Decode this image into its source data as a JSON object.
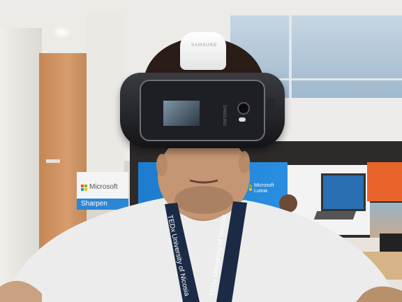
{
  "scene": {
    "kind": "photo",
    "description_colors": {
      "wall": "#e8e6e2",
      "wood_door": "#c98f60",
      "glass_panel": "#a9c2d6",
      "tshirt": "#ebebeb",
      "headset": "#1c1c20",
      "lanyard": "#1b2b45",
      "brand_blue": "#1f76c8",
      "brand_orange": "#e8642a"
    }
  },
  "banner": {
    "brand": "Microsoft",
    "tagline_partial": "Sharpen"
  },
  "display_wall": {
    "center_sign": "Microsoft Lumia"
  },
  "headset": {
    "brand_on_top": "SAMSUNG",
    "brand_on_phone": "SAMSUNG"
  },
  "lanyard": {
    "text_left": "TEDx University of Nicosia",
    "text_right": "TEDx University of Nicosia"
  }
}
